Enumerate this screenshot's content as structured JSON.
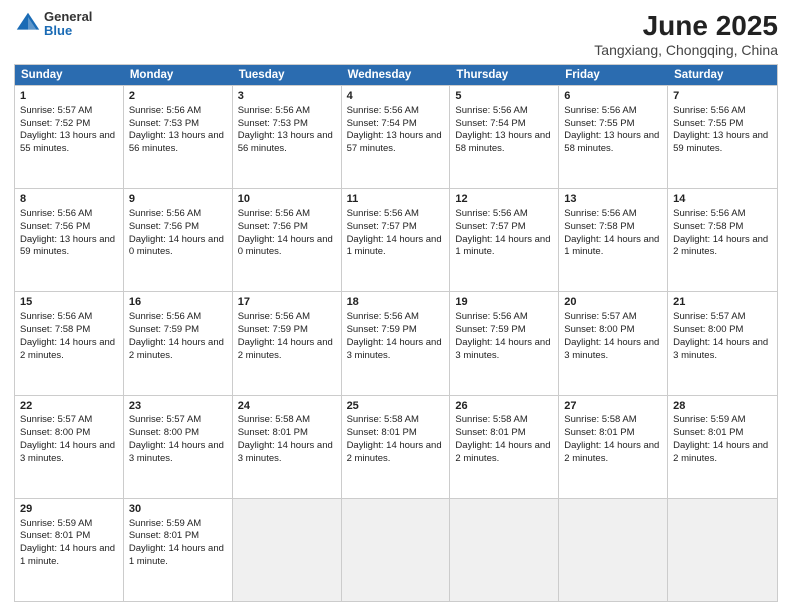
{
  "header": {
    "logo_general": "General",
    "logo_blue": "Blue",
    "title": "June 2025",
    "subtitle": "Tangxiang, Chongqing, China"
  },
  "calendar": {
    "days": [
      "Sunday",
      "Monday",
      "Tuesday",
      "Wednesday",
      "Thursday",
      "Friday",
      "Saturday"
    ],
    "rows": [
      [
        {
          "day": "1",
          "sunrise": "5:57 AM",
          "sunset": "7:52 PM",
          "daylight": "13 hours and 55 minutes."
        },
        {
          "day": "2",
          "sunrise": "5:56 AM",
          "sunset": "7:53 PM",
          "daylight": "13 hours and 56 minutes."
        },
        {
          "day": "3",
          "sunrise": "5:56 AM",
          "sunset": "7:53 PM",
          "daylight": "13 hours and 56 minutes."
        },
        {
          "day": "4",
          "sunrise": "5:56 AM",
          "sunset": "7:54 PM",
          "daylight": "13 hours and 57 minutes."
        },
        {
          "day": "5",
          "sunrise": "5:56 AM",
          "sunset": "7:54 PM",
          "daylight": "13 hours and 58 minutes."
        },
        {
          "day": "6",
          "sunrise": "5:56 AM",
          "sunset": "7:55 PM",
          "daylight": "13 hours and 58 minutes."
        },
        {
          "day": "7",
          "sunrise": "5:56 AM",
          "sunset": "7:55 PM",
          "daylight": "13 hours and 59 minutes."
        }
      ],
      [
        {
          "day": "8",
          "sunrise": "5:56 AM",
          "sunset": "7:56 PM",
          "daylight": "13 hours and 59 minutes."
        },
        {
          "day": "9",
          "sunrise": "5:56 AM",
          "sunset": "7:56 PM",
          "daylight": "14 hours and 0 minutes."
        },
        {
          "day": "10",
          "sunrise": "5:56 AM",
          "sunset": "7:56 PM",
          "daylight": "14 hours and 0 minutes."
        },
        {
          "day": "11",
          "sunrise": "5:56 AM",
          "sunset": "7:57 PM",
          "daylight": "14 hours and 1 minute."
        },
        {
          "day": "12",
          "sunrise": "5:56 AM",
          "sunset": "7:57 PM",
          "daylight": "14 hours and 1 minute."
        },
        {
          "day": "13",
          "sunrise": "5:56 AM",
          "sunset": "7:58 PM",
          "daylight": "14 hours and 1 minute."
        },
        {
          "day": "14",
          "sunrise": "5:56 AM",
          "sunset": "7:58 PM",
          "daylight": "14 hours and 2 minutes."
        }
      ],
      [
        {
          "day": "15",
          "sunrise": "5:56 AM",
          "sunset": "7:58 PM",
          "daylight": "14 hours and 2 minutes."
        },
        {
          "day": "16",
          "sunrise": "5:56 AM",
          "sunset": "7:59 PM",
          "daylight": "14 hours and 2 minutes."
        },
        {
          "day": "17",
          "sunrise": "5:56 AM",
          "sunset": "7:59 PM",
          "daylight": "14 hours and 2 minutes."
        },
        {
          "day": "18",
          "sunrise": "5:56 AM",
          "sunset": "7:59 PM",
          "daylight": "14 hours and 3 minutes."
        },
        {
          "day": "19",
          "sunrise": "5:56 AM",
          "sunset": "7:59 PM",
          "daylight": "14 hours and 3 minutes."
        },
        {
          "day": "20",
          "sunrise": "5:57 AM",
          "sunset": "8:00 PM",
          "daylight": "14 hours and 3 minutes."
        },
        {
          "day": "21",
          "sunrise": "5:57 AM",
          "sunset": "8:00 PM",
          "daylight": "14 hours and 3 minutes."
        }
      ],
      [
        {
          "day": "22",
          "sunrise": "5:57 AM",
          "sunset": "8:00 PM",
          "daylight": "14 hours and 3 minutes."
        },
        {
          "day": "23",
          "sunrise": "5:57 AM",
          "sunset": "8:00 PM",
          "daylight": "14 hours and 3 minutes."
        },
        {
          "day": "24",
          "sunrise": "5:58 AM",
          "sunset": "8:01 PM",
          "daylight": "14 hours and 3 minutes."
        },
        {
          "day": "25",
          "sunrise": "5:58 AM",
          "sunset": "8:01 PM",
          "daylight": "14 hours and 2 minutes."
        },
        {
          "day": "26",
          "sunrise": "5:58 AM",
          "sunset": "8:01 PM",
          "daylight": "14 hours and 2 minutes."
        },
        {
          "day": "27",
          "sunrise": "5:58 AM",
          "sunset": "8:01 PM",
          "daylight": "14 hours and 2 minutes."
        },
        {
          "day": "28",
          "sunrise": "5:59 AM",
          "sunset": "8:01 PM",
          "daylight": "14 hours and 2 minutes."
        }
      ],
      [
        {
          "day": "29",
          "sunrise": "5:59 AM",
          "sunset": "8:01 PM",
          "daylight": "14 hours and 1 minute."
        },
        {
          "day": "30",
          "sunrise": "5:59 AM",
          "sunset": "8:01 PM",
          "daylight": "14 hours and 1 minute."
        },
        null,
        null,
        null,
        null,
        null
      ]
    ]
  }
}
